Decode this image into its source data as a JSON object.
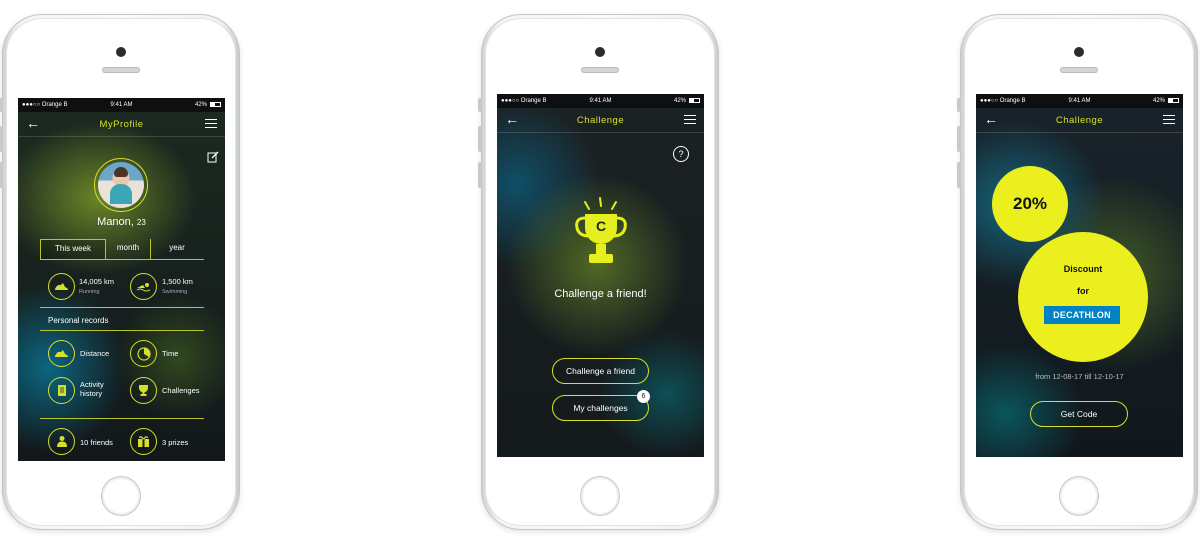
{
  "statusbar": {
    "carrier": "●●●○○ Orange B",
    "time": "9:41 AM",
    "battery": "42%"
  },
  "screen1": {
    "title": "MyProfile",
    "user_name": "Manon,",
    "user_age": "23",
    "tabs": [
      "This week",
      "month",
      "year"
    ],
    "stats": [
      {
        "value": "14,005 km",
        "label": "Running"
      },
      {
        "value": "1,500 km",
        "label": "Swimming"
      }
    ],
    "records_heading": "Personal records",
    "records": [
      {
        "label": "Distance"
      },
      {
        "label": "Time"
      },
      {
        "label": "Activity history"
      },
      {
        "label": "Challenges"
      }
    ],
    "footer": [
      {
        "label": "10 friends"
      },
      {
        "label": "3 prizes"
      }
    ]
  },
  "screen2": {
    "title": "Challenge",
    "help": "?",
    "trophy_letter": "C",
    "headline": "Challenge a friend!",
    "buttons": [
      {
        "label": "Challenge a friend"
      },
      {
        "label": "My challenges",
        "badge": "6"
      }
    ]
  },
  "screen3": {
    "title": "Challenge",
    "discount_value": "20%",
    "discount_line1": "Discount",
    "discount_line2": "for",
    "brand": "DECATHLON",
    "validity": "from 12-08-17 till 12-10-17",
    "button_label": "Get Code"
  },
  "colors": {
    "accent": "#d6e02a",
    "brand_blue": "#0082c3"
  }
}
